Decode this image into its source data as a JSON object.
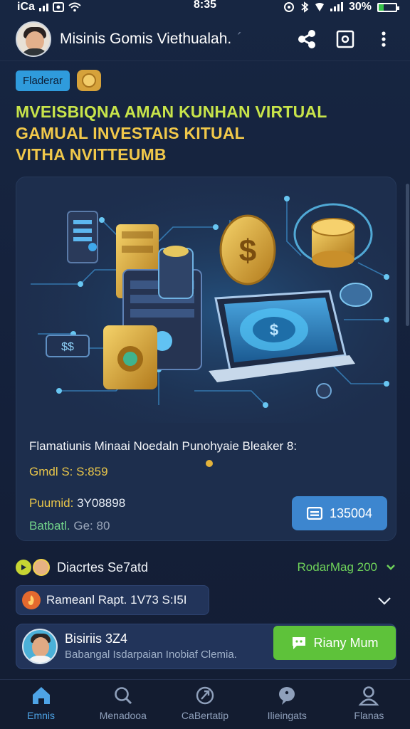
{
  "status_bar": {
    "carrier": "iCa",
    "time": "8:35",
    "battery_text": "30%",
    "battery_level": 0.3
  },
  "header": {
    "title": "Misinis Gomis Viethualah.",
    "title_suffix": "´"
  },
  "badges": {
    "tag": "Fladerar"
  },
  "headline": {
    "line1": "MVEISBIQNA AMAN KUNHAN VIRTUAL",
    "line2": "GAMUAL INVESTAIS KITUAL",
    "line3": "VITHA NVITTEUMB"
  },
  "card": {
    "caption": "Flamatiunis Minaai Noedaln Punohyaie Bleaker 8:",
    "line1_label": "Gmdl S: ",
    "line1_value": "S:859",
    "line2_label": "Puumid: ",
    "line2_value": "3Y08898",
    "line3_label": "Batbatl. ",
    "line3_value": "Ge: 80",
    "price_button": "135004"
  },
  "section": {
    "title": "Diacrtes Se7atd",
    "right_text": "RodarMag 200"
  },
  "promo": {
    "text": "Rameanl Rapt. 1V73 S:I5I"
  },
  "seller": {
    "name": "Bisiriis 3Z4",
    "description": "Babangal Isdarpaian Inobiaf Clemia.",
    "chat_button": "Riany Mum"
  },
  "nav": [
    {
      "label": "Emnis",
      "icon": "home-icon"
    },
    {
      "label": "Menadooa",
      "icon": "search-icon"
    },
    {
      "label": "CaBertatip",
      "icon": "rocket-icon"
    },
    {
      "label": "Ilieingats",
      "icon": "chat-icon"
    },
    {
      "label": "Flanas",
      "icon": "profile-icon"
    }
  ],
  "colors": {
    "accent_blue": "#3d86cf",
    "accent_green": "#5ec23a",
    "headline_yellow": "#f1c84a",
    "headline_lime": "#c8e44a",
    "background": "#16233a"
  }
}
